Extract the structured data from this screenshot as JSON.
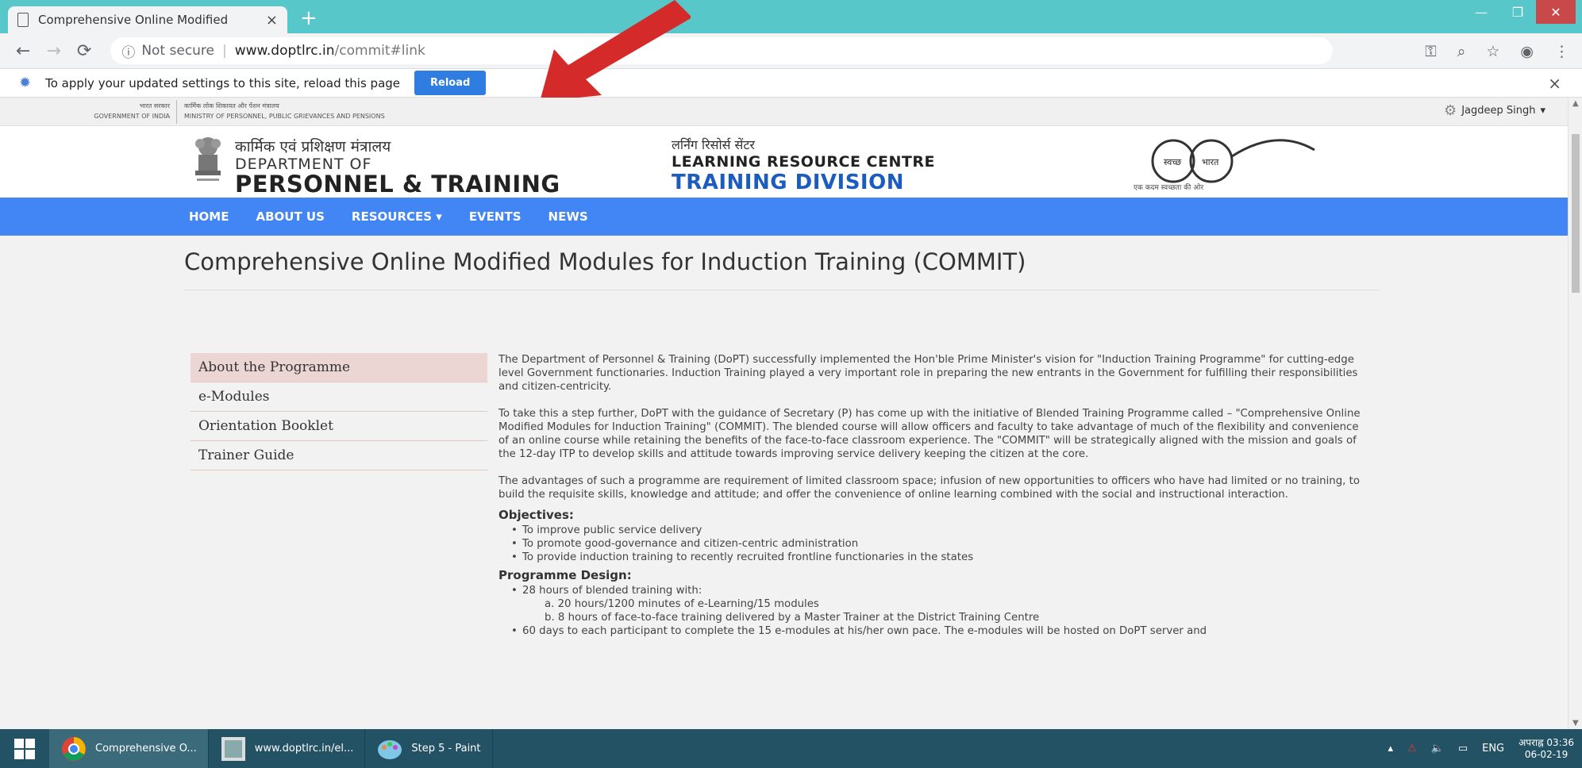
{
  "browser": {
    "tab_title": "Comprehensive Online Modified",
    "tab_close": "×",
    "new_tab": "+",
    "url_security": "Not secure",
    "url_domain": "www.doptlrc.in",
    "url_path": "/commit#link",
    "infobar_message": "To apply your updated settings to this site, reload this page",
    "reload_label": "Reload",
    "infobar_close": "×"
  },
  "gov_strip": {
    "left_hi": "भारत सरकार",
    "left_en": "GOVERNMENT OF INDIA",
    "right_hi": "कार्मिक लोक शिकायत और पेंशन मंत्रालय",
    "right_en": "MINISTRY OF PERSONNEL, PUBLIC GRIEVANCES AND PENSIONS",
    "user_name": "Jagdeep Singh"
  },
  "header": {
    "dept_hi": "कार्मिक एवं प्रशिक्षण मंत्रालय",
    "dept_en1": "DEPARTMENT OF",
    "dept_en2": "PERSONNEL & TRAINING",
    "lrc_hi": "लर्निंग रिसोर्स सेंटर",
    "lrc_en1": "LEARNING RESOURCE CENTRE",
    "lrc_en2": "TRAINING DIVISION",
    "swachh_left": "स्वच्छ",
    "swachh_right": "भारत",
    "swachh_tag": "एक कदम स्वच्छता की ओर"
  },
  "nav": {
    "home": "HOME",
    "about": "ABOUT US",
    "resources": "RESOURCES ▾",
    "events": "EVENTS",
    "news": "NEWS"
  },
  "page": {
    "title": "Comprehensive Online Modified Modules for Induction Training (COMMIT)",
    "side_menu": [
      "About the Programme",
      "e-Modules",
      "Orientation Booklet",
      "Trainer Guide"
    ],
    "para1": "The Department of Personnel & Training (DoPT) successfully implemented the Hon'ble Prime Minister's vision for \"Induction Training Programme\" for cutting-edge level Government functionaries. Induction Training played a very important role in preparing the new entrants in the Government for fulfilling their responsibilities and citizen-centricity.",
    "para2": "To take this a step further, DoPT with the guidance of Secretary (P) has come up with the initiative of Blended Training Programme called – \"Comprehensive Online Modified Modules for Induction Training\" (COMMIT). The blended course will allow officers and faculty to take advantage of much of the flexibility and convenience of an online course while retaining the benefits of the face-to-face classroom experience. The \"COMMIT\" will be strategically aligned with the mission and goals of the 12-day ITP to develop skills and attitude towards improving service delivery keeping the citizen at the core.",
    "para3": "The advantages of such a programme are requirement of limited classroom space; infusion of new opportunities to officers who have had limited or no training, to build the requisite skills, knowledge and attitude; and offer the convenience of online learning combined with the social and instructional interaction.",
    "objectives_heading": "Objectives:",
    "objectives": [
      "To improve public service delivery",
      "To promote good-governance and citizen-centric administration",
      "To provide induction training to recently recruited frontline functionaries in the states"
    ],
    "design_heading": "Programme Design:",
    "design_item1": "28 hours of blended training with:",
    "design_sub_a": "a. 20 hours/1200 minutes of e-Learning/15 modules",
    "design_sub_b": "b. 8 hours of face-to-face training delivered by a Master Trainer at the District Training Centre",
    "design_item2": "60 days to each participant to complete the 15 e-modules at his/her own pace. The e-modules will be hosted on DoPT server and"
  },
  "taskbar": {
    "item1": "Comprehensive O...",
    "item2": "www.doptlrc.in/el...",
    "item3": "Step 5 - Paint",
    "lang": "ENG",
    "time": "अपराह्न 03:36",
    "date": "06-02-19"
  },
  "colors": {
    "tabbar": "#57c7c9",
    "nav": "#4285f4",
    "reload_button": "#2f7de1",
    "active_menu": "#ecd6d3",
    "taskbar": "#235264",
    "arrow": "#d42a2a"
  }
}
